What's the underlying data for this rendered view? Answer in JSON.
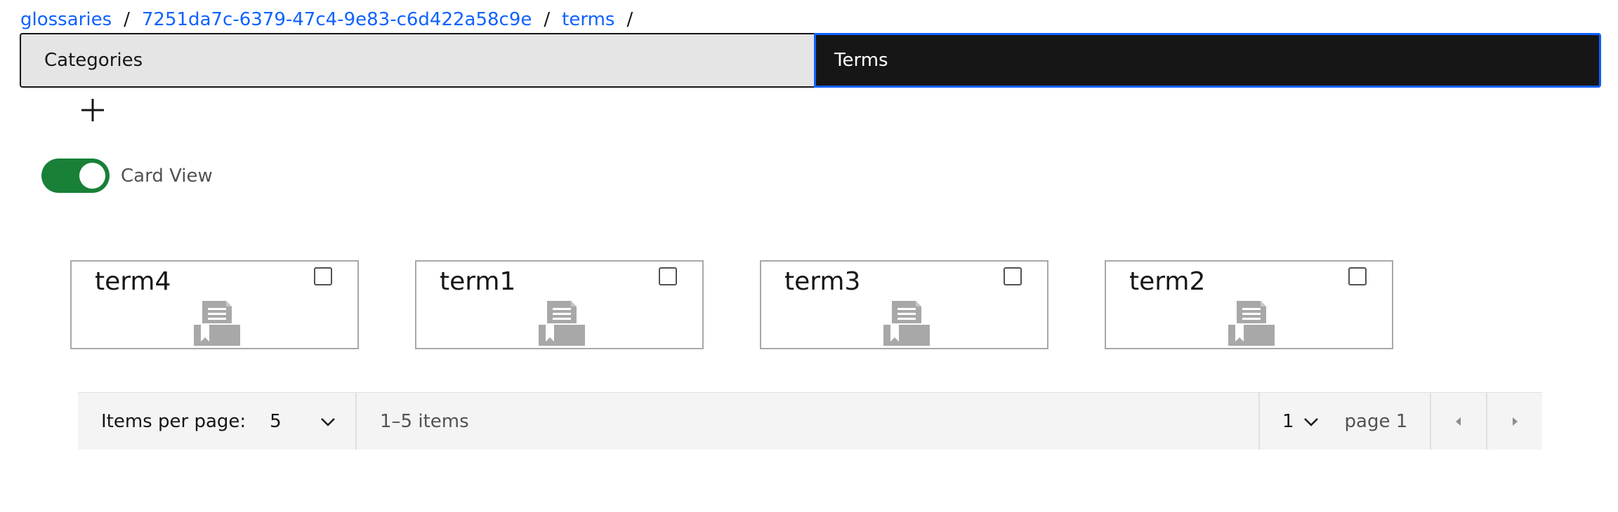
{
  "breadcrumb": {
    "items": [
      "glossaries",
      "7251da7c-6379-47c4-9e83-c6d422a58c9e",
      "terms"
    ],
    "separator": "/"
  },
  "tabs": [
    {
      "label": "Categories",
      "selected": false
    },
    {
      "label": "Terms",
      "selected": true
    }
  ],
  "add_icon": "plus-icon",
  "view_toggle": {
    "label": "Card View",
    "on": true
  },
  "cards": [
    {
      "title": "term4",
      "icon": "document-bookmark-icon",
      "checked": false
    },
    {
      "title": "term1",
      "icon": "document-bookmark-icon",
      "checked": false
    },
    {
      "title": "term3",
      "icon": "document-bookmark-icon",
      "checked": false
    },
    {
      "title": "term2",
      "icon": "document-bookmark-icon",
      "checked": false
    }
  ],
  "pagination": {
    "items_per_page_label": "Items per page:",
    "items_per_page": "5",
    "range_text": "1–5 items",
    "page": "1",
    "page_text": "page 1"
  },
  "colors": {
    "link": "#0f62fe",
    "toggle_on": "#198038",
    "tab_selected_bg": "#161616",
    "tab_selected_border": "#0f62fe",
    "tab_bg": "#e5e5e5",
    "card_border": "#a8a8a8",
    "icon_gray": "#a8a8a8"
  }
}
